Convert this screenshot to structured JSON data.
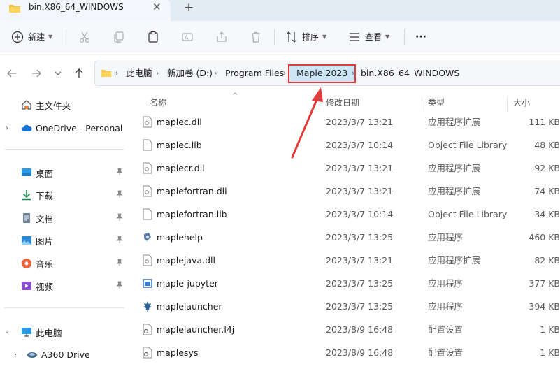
{
  "tab": {
    "title": "bin.X86_64_WINDOWS",
    "close": "✕",
    "new_tab": "+"
  },
  "toolbar": {
    "new_label": "新建",
    "sort_label": "排序",
    "view_label": "查看",
    "more_label": "···"
  },
  "address": {
    "crumbs": [
      "此电脑",
      "新加卷 (D:)",
      "Program Files",
      "Maple 2023",
      "bin.X86_64_WINDOWS"
    ],
    "highlighted_crumb": "Maple 2023",
    "highlight_color": "#e23b3b"
  },
  "sidebar": {
    "items": [
      {
        "label": "主文件夹",
        "icon": "home-icon"
      },
      {
        "label": "OneDrive - Personal",
        "icon": "cloud-icon"
      },
      {
        "label": "桌面",
        "icon": "desktop-icon"
      },
      {
        "label": "下载",
        "icon": "download-icon"
      },
      {
        "label": "文档",
        "icon": "document-icon"
      },
      {
        "label": "图片",
        "icon": "picture-icon"
      },
      {
        "label": "音乐",
        "icon": "music-icon"
      },
      {
        "label": "视频",
        "icon": "video-icon"
      },
      {
        "label": "此电脑",
        "icon": "computer-icon"
      },
      {
        "label": "A360 Drive",
        "icon": "drive-icon"
      }
    ]
  },
  "columns": {
    "name": "名称",
    "date": "修改日期",
    "type": "类型",
    "size": "大小"
  },
  "files": [
    {
      "name": "maplec.dll",
      "date": "2023/3/7 13:21",
      "type": "应用程序扩展",
      "size": "111 KB",
      "icon": "dll-icon"
    },
    {
      "name": "maplec.lib",
      "date": "2023/3/7 10:14",
      "type": "Object File Library",
      "size": "48 KB",
      "icon": "file-icon"
    },
    {
      "name": "maplecr.dll",
      "date": "2023/3/7 13:21",
      "type": "应用程序扩展",
      "size": "92 KB",
      "icon": "dll-icon"
    },
    {
      "name": "maplefortran.dll",
      "date": "2023/3/7 13:21",
      "type": "应用程序扩展",
      "size": "74 KB",
      "icon": "dll-icon"
    },
    {
      "name": "maplefortran.lib",
      "date": "2023/3/7 10:14",
      "type": "Object File Library",
      "size": "34 KB",
      "icon": "file-icon"
    },
    {
      "name": "maplehelp",
      "date": "2023/3/7 13:25",
      "type": "应用程序",
      "size": "460 KB",
      "icon": "exe-icon"
    },
    {
      "name": "maplejava.dll",
      "date": "2023/3/7 13:21",
      "type": "应用程序扩展",
      "size": "82 KB",
      "icon": "dll-icon"
    },
    {
      "name": "maple-jupyter",
      "date": "2023/3/7 13:25",
      "type": "应用程序",
      "size": "377 KB",
      "icon": "window-icon"
    },
    {
      "name": "maplelauncher",
      "date": "2023/3/7 13:25",
      "type": "应用程序",
      "size": "394 KB",
      "icon": "maple-leaf-icon"
    },
    {
      "name": "maplelauncher.l4j",
      "date": "2023/8/9 16:48",
      "type": "配置设置",
      "size": "1 KB",
      "icon": "config-icon"
    },
    {
      "name": "maplesys",
      "date": "2023/8/9 16:48",
      "type": "配置设置",
      "size": "1 KB",
      "icon": "config-icon"
    }
  ]
}
